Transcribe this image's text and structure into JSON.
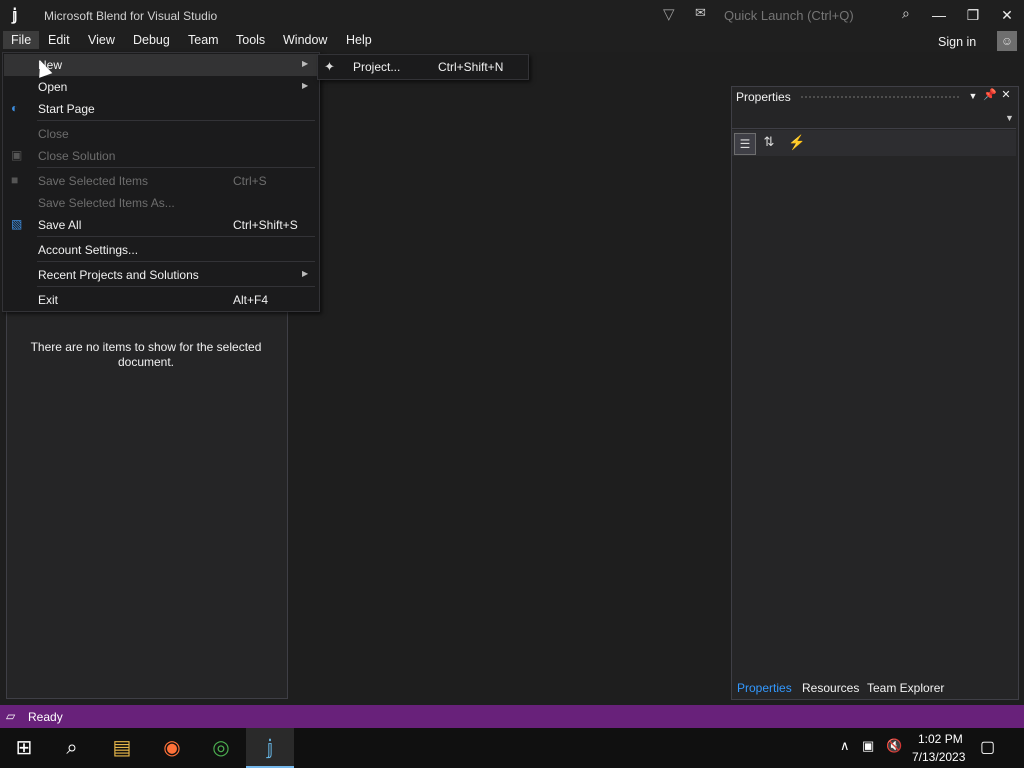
{
  "window": {
    "title": "Microsoft Blend for Visual Studio",
    "quick_launch_placeholder": "Quick Launch (Ctrl+Q)",
    "sign_in": "Sign in"
  },
  "menubar": {
    "items": [
      "File",
      "Edit",
      "View",
      "Debug",
      "Team",
      "Tools",
      "Window",
      "Help"
    ]
  },
  "file_menu": {
    "items": [
      {
        "label": "New",
        "shortcut": "",
        "submenu": true,
        "enabled": true
      },
      {
        "label": "Open",
        "shortcut": "",
        "submenu": true,
        "enabled": true
      },
      {
        "label": "Start Page",
        "shortcut": "",
        "submenu": false,
        "enabled": true
      },
      {
        "label": "Close",
        "shortcut": "",
        "submenu": false,
        "enabled": false
      },
      {
        "label": "Close Solution",
        "shortcut": "",
        "submenu": false,
        "enabled": false
      },
      {
        "label": "Save Selected Items",
        "shortcut": "Ctrl+S",
        "submenu": false,
        "enabled": false
      },
      {
        "label": "Save Selected Items As...",
        "shortcut": "",
        "submenu": false,
        "enabled": false
      },
      {
        "label": "Save All",
        "shortcut": "Ctrl+Shift+S",
        "submenu": false,
        "enabled": true
      },
      {
        "label": "Account Settings...",
        "shortcut": "",
        "submenu": false,
        "enabled": true
      },
      {
        "label": "Recent Projects and Solutions",
        "shortcut": "",
        "submenu": true,
        "enabled": true
      },
      {
        "label": "Exit",
        "shortcut": "Alt+F4",
        "submenu": false,
        "enabled": true
      }
    ]
  },
  "new_submenu": {
    "project_label": "Project...",
    "project_shortcut": "Ctrl+Shift+N"
  },
  "left_panel": {
    "empty_message": "There are no items to show for the selected document."
  },
  "properties_panel": {
    "title": "Properties",
    "tabs": [
      "Properties",
      "Resources",
      "Team Explorer"
    ],
    "active_tab": "Properties"
  },
  "statusbar": {
    "text": "Ready",
    "color": "#68217a"
  },
  "taskbar": {
    "time": "1:02 PM",
    "date": "7/13/2023"
  },
  "icons": {
    "app_logo": "blend-logo-icon",
    "accent": "#3399ff"
  }
}
